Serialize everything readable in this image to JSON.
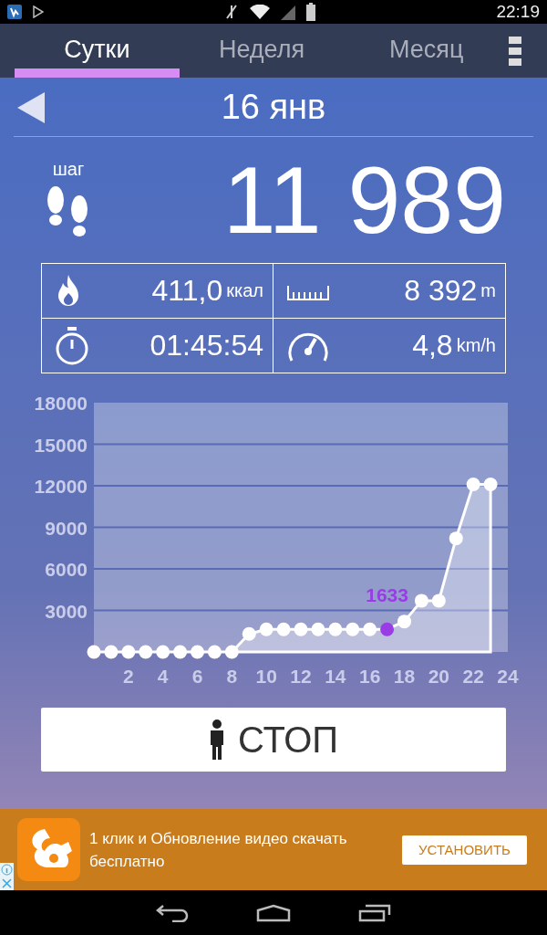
{
  "status_bar": {
    "time": "22:19"
  },
  "tabs": [
    {
      "label": "Сутки",
      "selected": true
    },
    {
      "label": "Неделя",
      "selected": false
    },
    {
      "label": "Месяц",
      "selected": false
    }
  ],
  "date": "16 янв",
  "steps": {
    "label": "шаг",
    "value": "11 989"
  },
  "stats": [
    {
      "kind": "calories",
      "value": "411,0",
      "unit": "ккал"
    },
    {
      "kind": "distance",
      "value": "8 392",
      "unit": "m"
    },
    {
      "kind": "time",
      "value": "01:45:54"
    },
    {
      "kind": "speed",
      "value": "4,8",
      "unit": "km/h"
    }
  ],
  "chart": {
    "chart_data": {
      "type": "area",
      "x": [
        0,
        1,
        2,
        3,
        4,
        5,
        6,
        7,
        8,
        9,
        10,
        11,
        12,
        13,
        14,
        15,
        16,
        17,
        18,
        19,
        20,
        21,
        22,
        23
      ],
      "grid": true,
      "series": [
        {
          "color": "#ffffff",
          "values": [
            0,
            0,
            0,
            0,
            0,
            0,
            0,
            0,
            0,
            1300,
            1633,
            1633,
            1633,
            1633,
            1633,
            1633,
            1633,
            1633,
            2200,
            3700,
            3700,
            8200,
            12100,
            12100
          ]
        }
      ],
      "xlim": [
        0,
        24
      ],
      "ylim": [
        0,
        18000
      ],
      "xticks": [
        2,
        4,
        6,
        8,
        10,
        12,
        14,
        16,
        18,
        20,
        22,
        24
      ],
      "yticks": [
        3000,
        6000,
        9000,
        12000,
        15000,
        18000
      ],
      "annotations": [
        {
          "x": 17,
          "y": 1633,
          "text": "1633"
        }
      ]
    }
  },
  "stop_button": {
    "label": "СТОП"
  },
  "ad": {
    "text": "1 клик и Обновление видео скачать бесплатно",
    "button": "УСТАНОВИТЬ"
  }
}
